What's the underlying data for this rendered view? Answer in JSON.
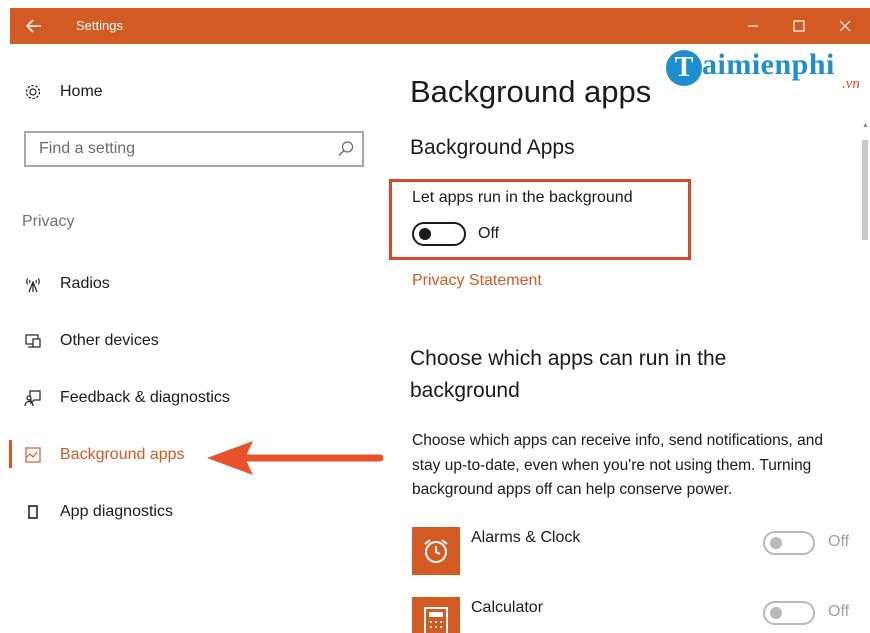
{
  "window": {
    "title": "Settings",
    "accent_color": "#d35a23"
  },
  "watermark": {
    "letter": "T",
    "text": "aimienphi",
    "suffix": ".vn"
  },
  "sidebar": {
    "home_label": "Home",
    "search_placeholder": "Find a setting",
    "section_label": "Privacy",
    "items": [
      {
        "label": "Radios",
        "icon": "radio-tower-icon"
      },
      {
        "label": "Other devices",
        "icon": "devices-icon"
      },
      {
        "label": "Feedback & diagnostics",
        "icon": "feedback-icon"
      },
      {
        "label": "Background apps",
        "icon": "background-apps-icon",
        "active": true
      },
      {
        "label": "App diagnostics",
        "icon": "app-diagnostics-icon"
      }
    ]
  },
  "main": {
    "page_title": "Background apps",
    "section_title": "Background Apps",
    "toggle_label": "Let apps run in the background",
    "toggle_state": "Off",
    "privacy_link": "Privacy Statement",
    "choose_heading": "Choose which apps can run in the background",
    "description": "Choose which apps can receive info, send notifications, and stay up-to-date, even when you're not using them. Turning background apps off can help conserve power.",
    "apps": [
      {
        "name": "Alarms & Clock",
        "state": "Off",
        "icon": "alarm-clock-icon"
      },
      {
        "name": "Calculator",
        "state": "Off",
        "icon": "calculator-icon"
      }
    ]
  }
}
